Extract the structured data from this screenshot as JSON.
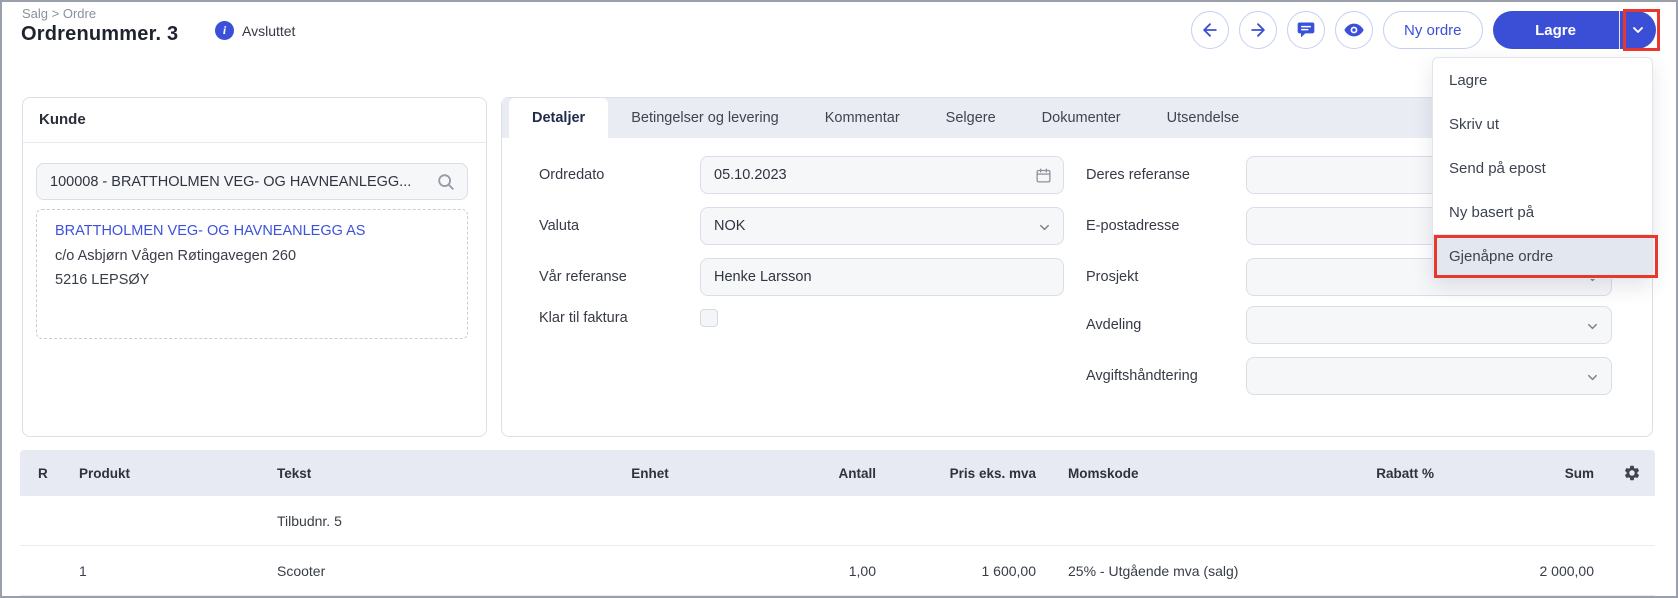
{
  "breadcrumb": {
    "path": "Salg > Ordre"
  },
  "page": {
    "title": "Ordrenummer. 3",
    "status": "Avsluttet"
  },
  "toolbar": {
    "new_order_label": "Ny ordre",
    "save_label": "Lagre"
  },
  "dropdown": {
    "items": [
      {
        "label": "Lagre",
        "highlighted": false
      },
      {
        "label": "Skriv ut",
        "highlighted": false
      },
      {
        "label": "Send på epost",
        "highlighted": false
      },
      {
        "label": "Ny basert på",
        "highlighted": false
      },
      {
        "label": "Gjenåpne ordre",
        "highlighted": true
      }
    ]
  },
  "customer": {
    "panel_title": "Kunde",
    "search_value": "100008 - BRATTHOLMEN VEG- OG HAVNEANLEGG...",
    "name": "BRATTHOLMEN VEG- OG HAVNEANLEGG AS",
    "address_line1": "c/o Asbjørn Vågen Røtingavegen 260",
    "address_line2": "5216 LEPSØY"
  },
  "tabs": [
    {
      "label": "Detaljer",
      "active": true
    },
    {
      "label": "Betingelser og levering",
      "active": false
    },
    {
      "label": "Kommentar",
      "active": false
    },
    {
      "label": "Selgere",
      "active": false
    },
    {
      "label": "Dokumenter",
      "active": false
    },
    {
      "label": "Utsendelse",
      "active": false
    }
  ],
  "form": {
    "ordredato": {
      "label": "Ordredato",
      "value": "05.10.2023"
    },
    "valuta": {
      "label": "Valuta",
      "value": "NOK"
    },
    "var_referanse": {
      "label": "Vår referanse",
      "value": "Henke Larsson"
    },
    "klar_til_faktura": {
      "label": "Klar til faktura",
      "checked": false
    },
    "deres_referanse": {
      "label": "Deres referanse",
      "value": ""
    },
    "epostadresse": {
      "label": "E-postadresse",
      "value": ""
    },
    "prosjekt": {
      "label": "Prosjekt",
      "value": ""
    },
    "avdeling": {
      "label": "Avdeling",
      "value": ""
    },
    "avgiftshandtering": {
      "label": "Avgiftshåndtering",
      "value": ""
    }
  },
  "table": {
    "headers": [
      "R",
      "Produkt",
      "Tekst",
      "Enhet",
      "Antall",
      "Pris eks. mva",
      "Momskode",
      "Rabatt %",
      "Sum"
    ],
    "rows": [
      {
        "r": "",
        "produkt": "",
        "tekst": "Tilbudnr. 5",
        "enhet": "",
        "antall": "",
        "pris": "",
        "momskode": "",
        "rabatt": "",
        "sum": ""
      },
      {
        "r": "",
        "produkt": "1",
        "tekst": "Scooter",
        "enhet": "",
        "antall": "1,00",
        "pris": "1 600,00",
        "momskode": "25% - Utgående mva (salg)",
        "rabatt": "",
        "sum": "2 000,00"
      }
    ]
  },
  "icons": {
    "status_badge": "info-circle",
    "customer_search": "magnifier",
    "order_date": "calendar",
    "select_fields": "chevron-down",
    "toolbar_buttons": [
      "arrow-left",
      "arrow-right",
      "chat-bubble",
      "eye"
    ],
    "save_menu": "chevron-down",
    "table_settings": "gear"
  },
  "colors": {
    "primary_blue": "#3a50d8",
    "annotation_red": "#e8382e",
    "tabstrip_bg": "#e9ecf3",
    "table_header_bg": "#e7eaf2",
    "field_bg": "#f6f7f9",
    "dropdown_highlight_bg": "#e3e7f0"
  }
}
